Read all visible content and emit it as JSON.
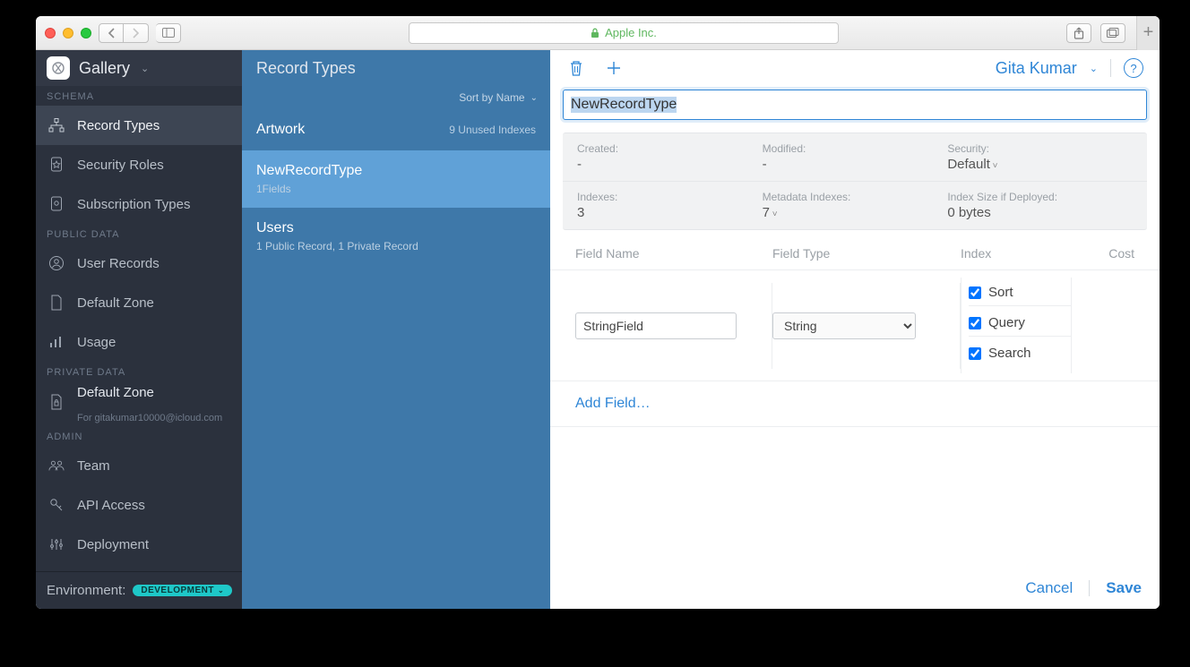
{
  "browser": {
    "address_label": "Apple Inc."
  },
  "sidebar": {
    "app_name": "Gallery",
    "sections": {
      "schema": "SCHEMA",
      "public": "PUBLIC DATA",
      "private": "PRIVATE DATA",
      "admin": "ADMIN"
    },
    "items": {
      "record_types": "Record Types",
      "security_roles": "Security Roles",
      "subscription_types": "Subscription Types",
      "user_records": "User Records",
      "default_zone": "Default Zone",
      "usage": "Usage",
      "priv_default_zone": "Default Zone",
      "priv_default_zone_sub": "For gitakumar10000@icloud.com",
      "team": "Team",
      "api_access": "API Access",
      "deployment": "Deployment"
    },
    "env_label": "Environment:",
    "env_value": "DEVELOPMENT"
  },
  "midcol": {
    "title": "Record Types",
    "sort_label": "Sort by Name",
    "items": [
      {
        "name": "Artwork",
        "meta_right": "9 Unused Indexes"
      },
      {
        "name": "NewRecordType",
        "meta": "1Fields"
      },
      {
        "name": "Users",
        "meta": "1 Public Record, 1 Private Record"
      }
    ]
  },
  "main": {
    "user_name": "Gita Kumar",
    "record_name": "NewRecordType",
    "meta": {
      "created_label": "Created:",
      "created_value": "-",
      "modified_label": "Modified:",
      "modified_value": "-",
      "security_label": "Security:",
      "security_value": "Default",
      "indexes_label": "Indexes:",
      "indexes_value": "3",
      "metadata_idx_label": "Metadata Indexes:",
      "metadata_idx_value": "7",
      "idx_size_label": "Index Size if Deployed:",
      "idx_size_value": "0 bytes"
    },
    "field_headers": {
      "name": "Field Name",
      "type": "Field Type",
      "index": "Index",
      "cost": "Cost"
    },
    "field_row": {
      "name": "StringField",
      "type": "String",
      "indexes": [
        "Sort",
        "Query",
        "Search"
      ]
    },
    "add_field": "Add Field…",
    "cancel": "Cancel",
    "save": "Save"
  }
}
